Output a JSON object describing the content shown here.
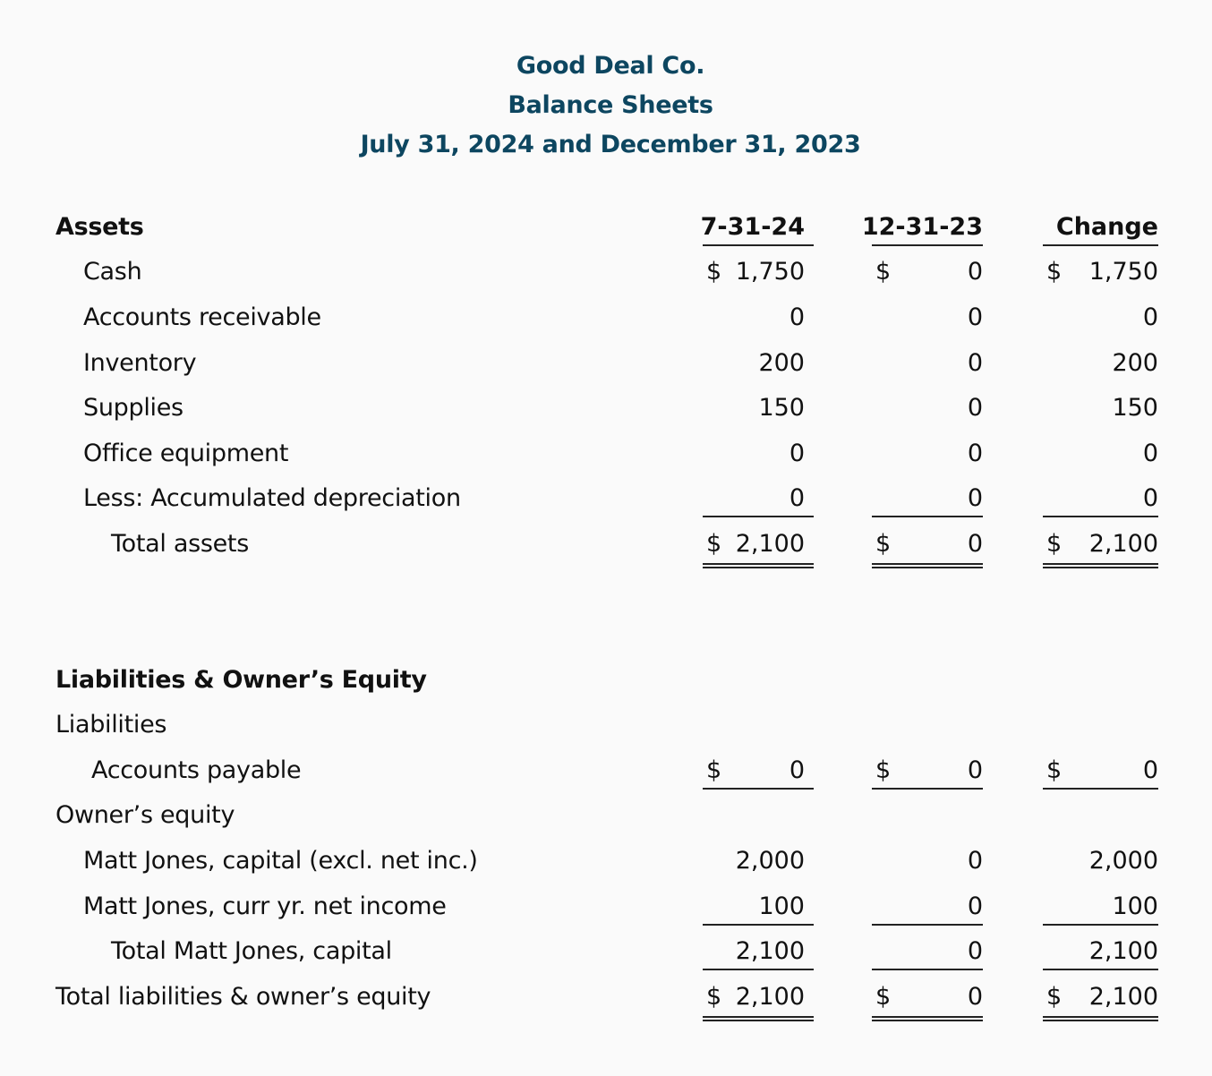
{
  "header": {
    "company": "Good Deal Co.",
    "statement": "Balance Sheets",
    "period": "July 31, 2024 and December 31, 2023"
  },
  "columns": [
    "7-31-24",
    "12-31-23",
    "Change"
  ],
  "assets": {
    "heading": "Assets",
    "rows": [
      {
        "label": "Cash",
        "values": [
          "1,750",
          "0",
          "1,750"
        ],
        "dollar": true
      },
      {
        "label": "Accounts receivable",
        "values": [
          "0",
          "0",
          "0"
        ]
      },
      {
        "label": "Inventory",
        "values": [
          "200",
          "0",
          "200"
        ]
      },
      {
        "label": "Supplies",
        "values": [
          "150",
          "0",
          "150"
        ]
      },
      {
        "label": "Office equipment",
        "values": [
          "0",
          "0",
          "0"
        ]
      },
      {
        "label": "Less: Accumulated depreciation",
        "values": [
          "0",
          "0",
          "0"
        ]
      }
    ],
    "total": {
      "label": "Total assets",
      "values": [
        "2,100",
        "0",
        "2,100"
      ],
      "dollar": true
    }
  },
  "liabilities_equity": {
    "heading": "Liabilities & Owner’s Equity",
    "liabilities_label": "Liabilities",
    "accounts_payable": {
      "label": "Accounts payable",
      "values": [
        "0",
        "0",
        "0"
      ],
      "dollar": true
    },
    "equity_label": "Owner’s equity",
    "capital": {
      "label": "Matt Jones, capital (excl. net inc.)",
      "values": [
        "2,000",
        "0",
        "2,000"
      ]
    },
    "net_income": {
      "label": "Matt Jones, curr yr. net income",
      "values": [
        "100",
        "0",
        "100"
      ]
    },
    "total_capital": {
      "label": "Total Matt Jones, capital",
      "values": [
        "2,100",
        "0",
        "2,100"
      ]
    },
    "total": {
      "label": "Total liabilities & owner’s equity",
      "values": [
        "2,100",
        "0",
        "2,100"
      ],
      "dollar": true
    }
  },
  "currency_symbol": "$",
  "colors": {
    "title": "#0d4660",
    "text": "#111111",
    "background": "#fafafa"
  }
}
